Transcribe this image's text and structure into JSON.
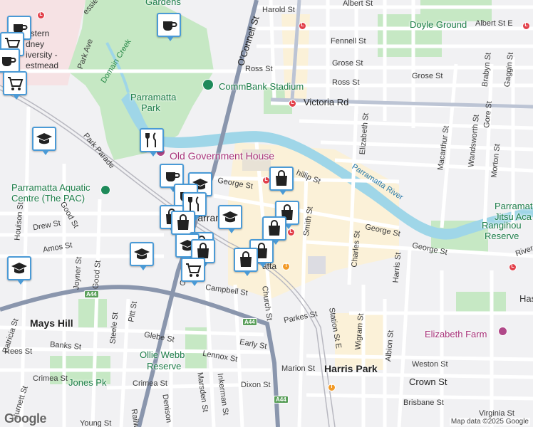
{
  "map": {
    "attribution": "Map data ©2025 Google",
    "logo": "Google",
    "colors": {
      "park": "#c6e8c4",
      "water": "#9fd6e8",
      "road": "#ffffff",
      "highway": "#8a96ad",
      "cbd": "#fbf1d8"
    },
    "areas": [
      {
        "id": "mays-hill",
        "text": "Mays Hill"
      },
      {
        "id": "harris-park",
        "text": "Harris Park"
      },
      {
        "id": "parramatta",
        "text": "Parramatta"
      }
    ],
    "pois": [
      {
        "id": "doyle-ground",
        "text": "Doyle Ground"
      },
      {
        "id": "commbank",
        "text": "CommBank Stadium"
      },
      {
        "id": "old-gov",
        "text": "Old Government House"
      },
      {
        "id": "aquatic1",
        "text": "Parramatta Aquatic"
      },
      {
        "id": "aquatic2",
        "text": "Centre (The PAC)"
      },
      {
        "id": "parramatta-park",
        "text": "Parramatta"
      },
      {
        "id": "parramatta-park2",
        "text": "Park"
      },
      {
        "id": "ollie1",
        "text": "Ollie Webb"
      },
      {
        "id": "ollie2",
        "text": "Reserve"
      },
      {
        "id": "jones-pk",
        "text": "Jones Pk"
      },
      {
        "id": "elizabeth-farm",
        "text": "Elizabeth Farm"
      },
      {
        "id": "rangihou1",
        "text": "Rangihou"
      },
      {
        "id": "rangihou2",
        "text": "Reserve"
      },
      {
        "id": "jitsu1",
        "text": "Parramat"
      },
      {
        "id": "jitsu2",
        "text": "Jitsu Aca"
      },
      {
        "id": "gardens",
        "text": "Gardens"
      },
      {
        "id": "wsu1",
        "text": "estern"
      },
      {
        "id": "wsu2",
        "text": "dney"
      },
      {
        "id": "wsu3",
        "text": "iversity -"
      },
      {
        "id": "wsu4",
        "text": "estmead"
      },
      {
        "id": "domain-creek",
        "text": "Domain Creek"
      },
      {
        "id": "river",
        "text": "Parramatta River"
      },
      {
        "id": "parramatta-stn",
        "text": "atta"
      }
    ],
    "streets": [
      {
        "id": "harold",
        "text": "Harold St"
      },
      {
        "id": "albert1",
        "text": "Albert St"
      },
      {
        "id": "albert2",
        "text": "Albert St E"
      },
      {
        "id": "fennell",
        "text": "Fennell St"
      },
      {
        "id": "grose1",
        "text": "Grose St"
      },
      {
        "id": "grose2",
        "text": "Grose St"
      },
      {
        "id": "ross1",
        "text": "Ross St"
      },
      {
        "id": "ross2",
        "text": "Ross St"
      },
      {
        "id": "victoria",
        "text": "Victoria Rd"
      },
      {
        "id": "oconnell",
        "text": "O'Connell St"
      },
      {
        "id": "park-ave",
        "text": "Park Ave"
      },
      {
        "id": "park-parade",
        "text": "Park Parade"
      },
      {
        "id": "george1",
        "text": "George St"
      },
      {
        "id": "george2",
        "text": "George St"
      },
      {
        "id": "george3",
        "text": "George St"
      },
      {
        "id": "phillip",
        "text": "hillip St"
      },
      {
        "id": "smith",
        "text": "Smith St"
      },
      {
        "id": "elizabeth",
        "text": "Elizabeth St"
      },
      {
        "id": "macarthur",
        "text": "Macarthur St"
      },
      {
        "id": "wandsworth",
        "text": "Wandsworth St"
      },
      {
        "id": "gore",
        "text": "Gore St"
      },
      {
        "id": "morton",
        "text": "Morton St"
      },
      {
        "id": "brabyn",
        "text": "Brabyn St"
      },
      {
        "id": "gaggin",
        "text": "Gaggin St"
      },
      {
        "id": "charles",
        "text": "Charles St"
      },
      {
        "id": "harris",
        "text": "Harris St"
      },
      {
        "id": "rivers",
        "text": "Rivers"
      },
      {
        "id": "houison",
        "text": "Houison St"
      },
      {
        "id": "good1",
        "text": "Good St"
      },
      {
        "id": "good2",
        "text": "Good St"
      },
      {
        "id": "drew",
        "text": "Drew St"
      },
      {
        "id": "amos",
        "text": "Amos St"
      },
      {
        "id": "joyner",
        "text": "Joyner St"
      },
      {
        "id": "campbell",
        "text": "Campbell St"
      },
      {
        "id": "church",
        "text": "Church St"
      },
      {
        "id": "parkes",
        "text": "Parkes St"
      },
      {
        "id": "station",
        "text": "Station St E"
      },
      {
        "id": "wigram",
        "text": "Wigram St"
      },
      {
        "id": "albion",
        "text": "Albion St"
      },
      {
        "id": "weston",
        "text": "Weston St"
      },
      {
        "id": "crown",
        "text": "Crown St"
      },
      {
        "id": "brisbane",
        "text": "Brisbane St"
      },
      {
        "id": "virginia",
        "text": "Virginia St"
      },
      {
        "id": "has",
        "text": "Has"
      },
      {
        "id": "marion",
        "text": "Marion St"
      },
      {
        "id": "dixon",
        "text": "Dixon St"
      },
      {
        "id": "early",
        "text": "Early St"
      },
      {
        "id": "lennox",
        "text": "Lennox St"
      },
      {
        "id": "glebe",
        "text": "Glebe St"
      },
      {
        "id": "banks",
        "text": "Banks St"
      },
      {
        "id": "rees",
        "text": "Rees St"
      },
      {
        "id": "crimea1",
        "text": "Crimea St"
      },
      {
        "id": "crimea2",
        "text": "Crimea St"
      },
      {
        "id": "pitt",
        "text": "Pitt St"
      },
      {
        "id": "steele",
        "text": "Steele St"
      },
      {
        "id": "marsden",
        "text": "Marsden St"
      },
      {
        "id": "inkerman",
        "text": "Inkerman St"
      },
      {
        "id": "denison",
        "text": "Denison"
      },
      {
        "id": "burnett",
        "text": "Burnett St"
      },
      {
        "id": "patricia",
        "text": "Patricia St"
      },
      {
        "id": "young",
        "text": "Young St"
      },
      {
        "id": "railw",
        "text": "Railw"
      },
      {
        "id": "essie",
        "text": "essie St"
      },
      {
        "id": "oc2",
        "text": "O"
      }
    ],
    "shields": [
      "A44",
      "A44",
      "A44"
    ]
  }
}
